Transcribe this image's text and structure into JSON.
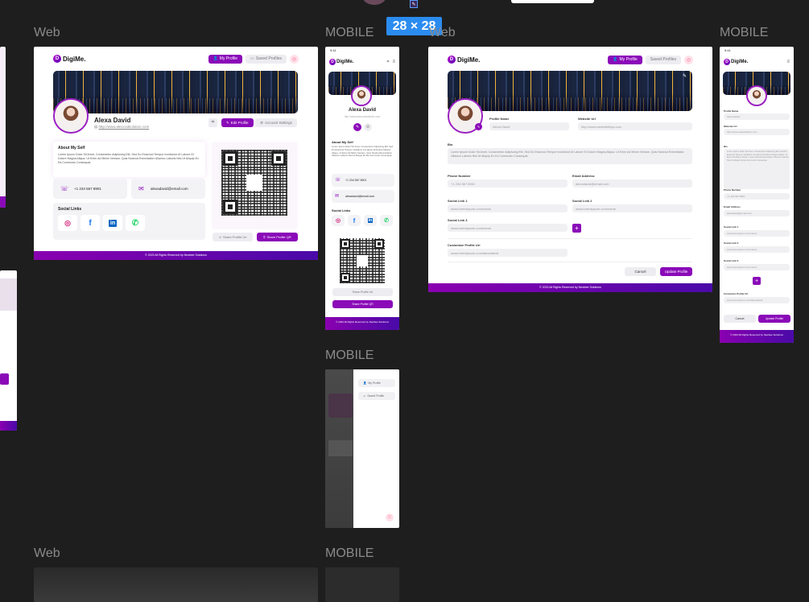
{
  "top": {
    "size_badge": "28 × 28"
  },
  "labels": {
    "web": "Web",
    "mobile": "MOBILE"
  },
  "brand": {
    "name": "DigiMe.",
    "mark": "D",
    "accent": "#8a0ab8",
    "gradient_start": "#8a00b0",
    "gradient_end": "#4a0aa8"
  },
  "nav": {
    "my_profile": "My Profile",
    "saved_profiles": "Saved Profiles"
  },
  "profile": {
    "name": "Alexa David",
    "website": "http://www.alexcodsolution.com",
    "edit_button": "Edit Profile",
    "settings_button": "Account Settings",
    "about_title": "About My Self",
    "about_text": "Lorem Ipsum Dolor Sit Amet, Consectetur Adipiscing Elit, Sed Do Eiusmod Tempor Incididunt Ut Labore Et Dolore Magna Aliqua. Ut Enim Ad Minim Veniam, Quis Nostrud Exercitation Ullamco Laboris Nisi Ut Aliquip Ex Ea Commodo Consequat.",
    "phone": "+1 234 567 8901",
    "email": "alexadavid@email.com",
    "social_title": "Social Links",
    "share_url": "Share Profile Url",
    "share_qr": "Share Profile QR",
    "footer": "© 2023 All Rights Reserved by Newbee Solutions"
  },
  "edit_form": {
    "profile_name_label": "Profile Name",
    "profile_name_value": "Alexa David",
    "website_label": "Website Url",
    "website_value": "http://www.websitethiys.com",
    "bio_label": "Bio",
    "bio_value": "Lorem Ipsum Dolor Sit Amet, Consectetur Adipiscing Elit, Sed Do Eiusmod Tempor Incididunt Ut Labore Et Dolore Magna Aliqua. Ut Enim Ad Minim Veniam, Quis Nostrud Exercitation Ullamco Laboris Nisi Ut Aliquip Ex Ea Commodo Consequat.",
    "phone_label": "Phone Number",
    "phone_value": "+1 234 567 8901",
    "email_label": "Email Address",
    "email_value": "alexadavid@email.com",
    "social1_label": "Social Link 1",
    "social1_value": "www.loremipsum.com/name",
    "social2_label": "Social Link 2",
    "social2_value": "www.loremipsum.com/name",
    "social3_label": "Social Link 3",
    "social3_value": "www.loremipsum.com/name",
    "custom_label": "Customize Profile Url",
    "custom_value": "www.loremipsum.com/alexadavid",
    "cancel": "Cancel",
    "update": "Update Profile",
    "footer": "© 2023 All Rights Reserved by Newbee Solutions"
  },
  "mobile_menu": {
    "my_profile": "My Profile",
    "saved_profiles": "Saved Profile"
  },
  "status_time": "9:41"
}
